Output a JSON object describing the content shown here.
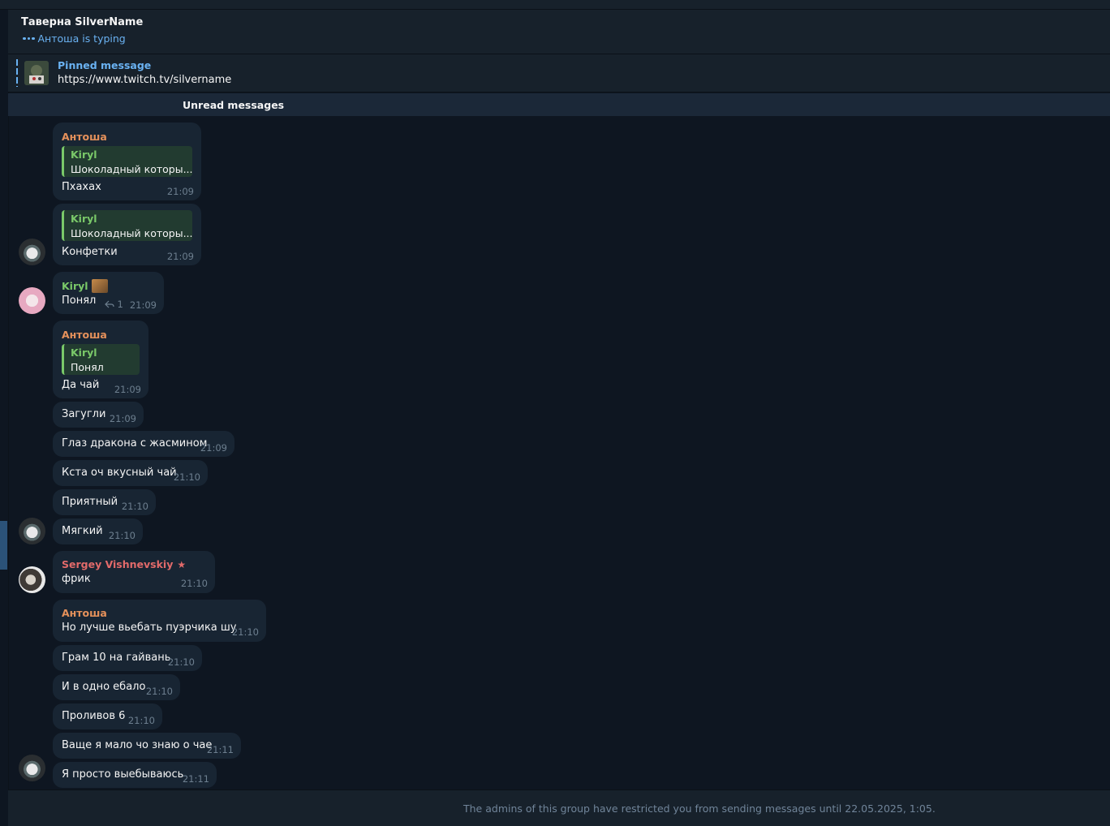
{
  "chat": {
    "title": "Таверна SilverName",
    "typing": "Антоша is typing"
  },
  "pinned": {
    "label": "Pinned message",
    "text": "https://www.twitch.tv/silvername"
  },
  "unread_label": "Unread messages",
  "messages": [
    {
      "sender": "Антоша",
      "reply_to": "Kiryl",
      "reply_text": "Шоколадный которы...",
      "text": "Пхахах",
      "time": "21:09"
    },
    {
      "reply_to": "Kiryl",
      "reply_text": "Шоколадный которы...",
      "text": "Конфетки",
      "time": "21:09"
    },
    {
      "sender": "Kiryl",
      "text": "Понял",
      "replies": "1",
      "time": "21:09"
    },
    {
      "sender": "Антоша",
      "reply_to": "Kiryl",
      "reply_text": "Понял",
      "text": "Да чай",
      "time": "21:09"
    },
    {
      "text": "Загугли",
      "time": "21:09"
    },
    {
      "text": "Глаз дракона с жасмином",
      "time": "21:09"
    },
    {
      "text": "Кста оч вкусный чай",
      "time": "21:10"
    },
    {
      "text": "Приятный",
      "time": "21:10"
    },
    {
      "text": "Мягкий",
      "time": "21:10"
    },
    {
      "sender": "Sergey Vishnevskiy",
      "text": "фрик",
      "time": "21:10"
    },
    {
      "sender": "Антоша",
      "text": "Но лучше вьебать пуэрчика шу",
      "time": "21:10"
    },
    {
      "text": "Грам 10 на гайвань",
      "time": "21:10"
    },
    {
      "text": "И в одно ебало",
      "time": "21:10"
    },
    {
      "text": "Проливов 6",
      "time": "21:10"
    },
    {
      "text": "Ваще я мало чо знаю о чае",
      "time": "21:11"
    },
    {
      "text": "Я просто выебываюсь",
      "time": "21:11"
    }
  ],
  "composer": {
    "restriction": "The admins of this group have restricted you from sending messages until 22.05.2025, 1:05."
  },
  "colors": {
    "background": "#0e1621",
    "bubble": "#182533",
    "accent": "#6ab2f2",
    "sender_antosha": "#e5915b",
    "sender_kiryl": "#7ac969",
    "sender_sergey": "#e26a6a"
  }
}
